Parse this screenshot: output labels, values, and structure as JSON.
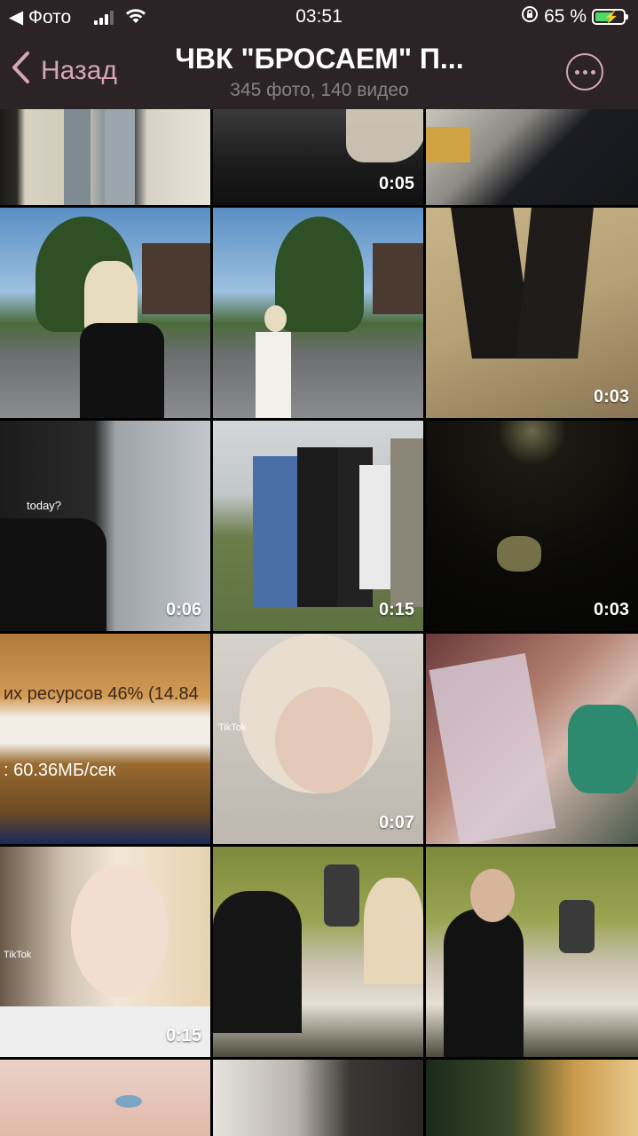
{
  "status_bar": {
    "back_app": "◀ Фото",
    "time": "03:51",
    "battery": "65 %"
  },
  "nav": {
    "back_label": "Назад",
    "title": "ЧВК \"БРОСАЕМ\" П...",
    "subtitle": "345 фото, 140 видео"
  },
  "grid": {
    "cells": [
      {
        "label": "photo-1",
        "duration": null
      },
      {
        "label": "video-1",
        "duration": "0:05"
      },
      {
        "label": "photo-2",
        "duration": null
      },
      {
        "label": "photo-3",
        "duration": null
      },
      {
        "label": "photo-4",
        "duration": null
      },
      {
        "label": "video-2",
        "duration": "0:03"
      },
      {
        "label": "video-3",
        "duration": "0:06",
        "overlay_text": "today?"
      },
      {
        "label": "video-4",
        "duration": "0:15"
      },
      {
        "label": "video-5",
        "duration": "0:03"
      },
      {
        "label": "photo-5",
        "duration": null,
        "overlay_lines": [
          "их ресурсов 46% (14.84",
          ":   60.36МБ/сек"
        ]
      },
      {
        "label": "video-6",
        "duration": "0:07",
        "overlay_text": "TikTok"
      },
      {
        "label": "photo-6",
        "duration": null
      },
      {
        "label": "video-7",
        "duration": "0:15",
        "overlay_text": "TikTok"
      },
      {
        "label": "photo-7",
        "duration": null
      },
      {
        "label": "photo-8",
        "duration": null
      },
      {
        "label": "photo-9",
        "duration": null
      },
      {
        "label": "photo-10",
        "duration": null
      },
      {
        "label": "photo-11",
        "duration": null
      }
    ]
  },
  "colors": {
    "header_bg": "#2b2326",
    "accent": "#d4a6b6",
    "battery_green": "#4cd964"
  }
}
